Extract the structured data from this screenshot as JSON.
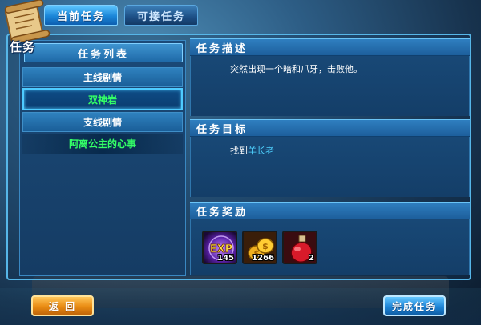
{
  "window": {
    "badge_label": "任务"
  },
  "tabs": [
    {
      "label": "当前任务",
      "active": true
    },
    {
      "label": "可接任务",
      "active": false
    }
  ],
  "task_list": {
    "header": "任务列表",
    "items": [
      {
        "label": "主线剧情",
        "kind": "category"
      },
      {
        "label": "双神岩",
        "kind": "quest",
        "selected": true
      },
      {
        "label": "支线剧情",
        "kind": "category"
      },
      {
        "label": "阿离公主的心事",
        "kind": "quest"
      }
    ]
  },
  "sections": {
    "description": {
      "title": "任务描述",
      "text": "突然出现一个暗和爪牙，击败他。"
    },
    "objective": {
      "title": "任务目标",
      "prefix": "找到",
      "npc": "羊长老"
    },
    "rewards": {
      "title": "任务奖励",
      "items": [
        {
          "icon": "exp-icon",
          "count": "145"
        },
        {
          "icon": "gold-coins-icon",
          "count": "1266"
        },
        {
          "icon": "red-potion-icon",
          "count": "2"
        }
      ]
    }
  },
  "buttons": {
    "back": "返 回",
    "complete": "完成任务"
  },
  "colors": {
    "quest_green": "#33ff66",
    "npc_blue": "#4fd2ff",
    "back_orange": "#e98b12",
    "done_blue": "#1e86d8"
  }
}
